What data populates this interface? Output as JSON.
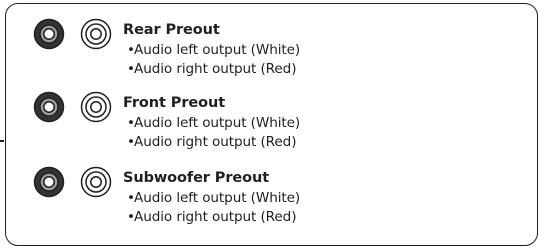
{
  "groups": [
    {
      "title": "Rear Preout",
      "items": [
        "Audio left output (White)",
        "Audio right output (Red)"
      ]
    },
    {
      "title": "Front Preout",
      "items": [
        "Audio left output (White)",
        "Audio right output (Red)"
      ]
    },
    {
      "title": "Subwoofer Preout",
      "items": [
        "Audio left output (White)",
        "Audio right output (Red)"
      ]
    }
  ],
  "bullet": "•",
  "colors": {
    "line": "#231f20",
    "dark_jack": "#333333",
    "jack_mid": "#9e9e9e"
  },
  "icons": {
    "dark_jack": "rca-jack-dark-icon",
    "light_jack": "rca-jack-light-icon"
  }
}
